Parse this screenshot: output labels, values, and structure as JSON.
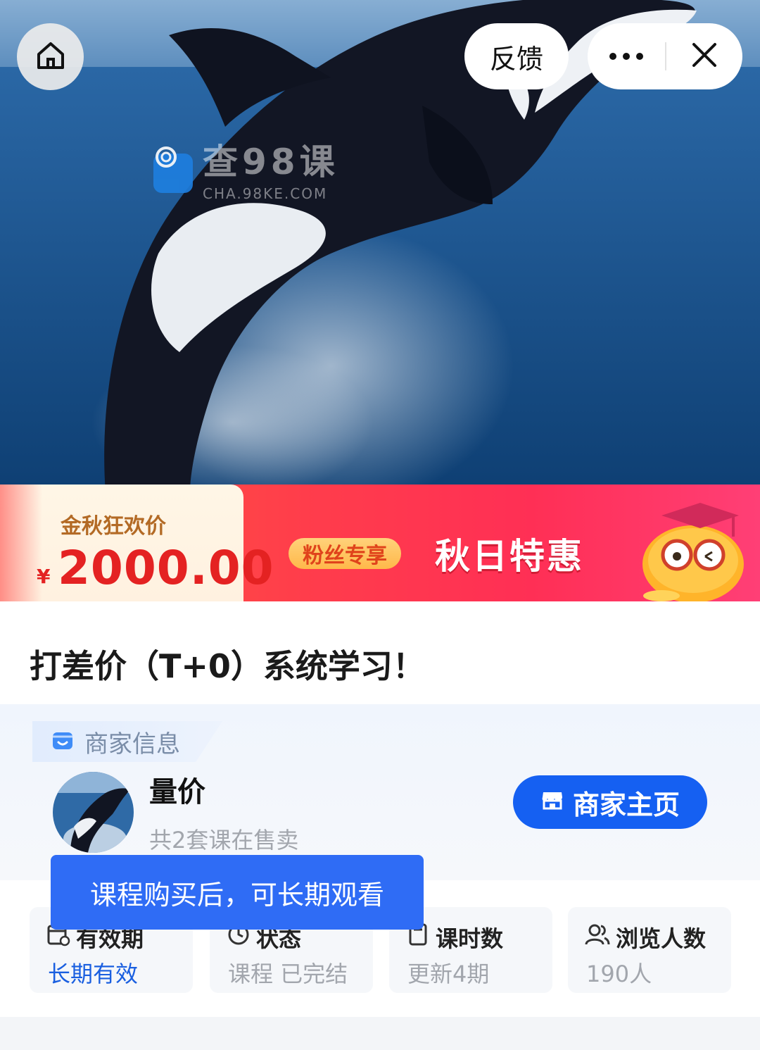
{
  "watermark": {
    "text": "查98课",
    "sub": "CHA.98KE.COM"
  },
  "nav": {
    "home_icon": "home-icon",
    "feedback_label": "反馈",
    "more_icon": "more-dots-icon",
    "close_icon": "close-icon"
  },
  "promo": {
    "label": "金秋狂欢价",
    "currency": "¥",
    "price": "2000.00",
    "fans_badge": "粉丝专享",
    "headline": "秋日特惠"
  },
  "course": {
    "title": "打差价（T+0）系统学习！"
  },
  "merchant": {
    "section_label": "商家信息",
    "name": "量价",
    "course_count_text": "共2套课在售卖",
    "home_button": "商家主页"
  },
  "toast": {
    "text": "课程购买后，可长期观看"
  },
  "stats": [
    {
      "label": "有效期",
      "value": "长期有效",
      "icon": "validity-calendar-icon"
    },
    {
      "label": "状态",
      "value": "课程 已完结",
      "icon": "clock-icon"
    },
    {
      "label": "课时数",
      "value": "更新4期",
      "icon": "document-icon"
    },
    {
      "label": "浏览人数",
      "value": "190人",
      "icon": "users-icon"
    }
  ],
  "colors": {
    "primary_blue": "#1560f2",
    "toast_blue": "#2f6cf5",
    "promo_red": "#ff3d4b",
    "price_red": "#e42222"
  }
}
